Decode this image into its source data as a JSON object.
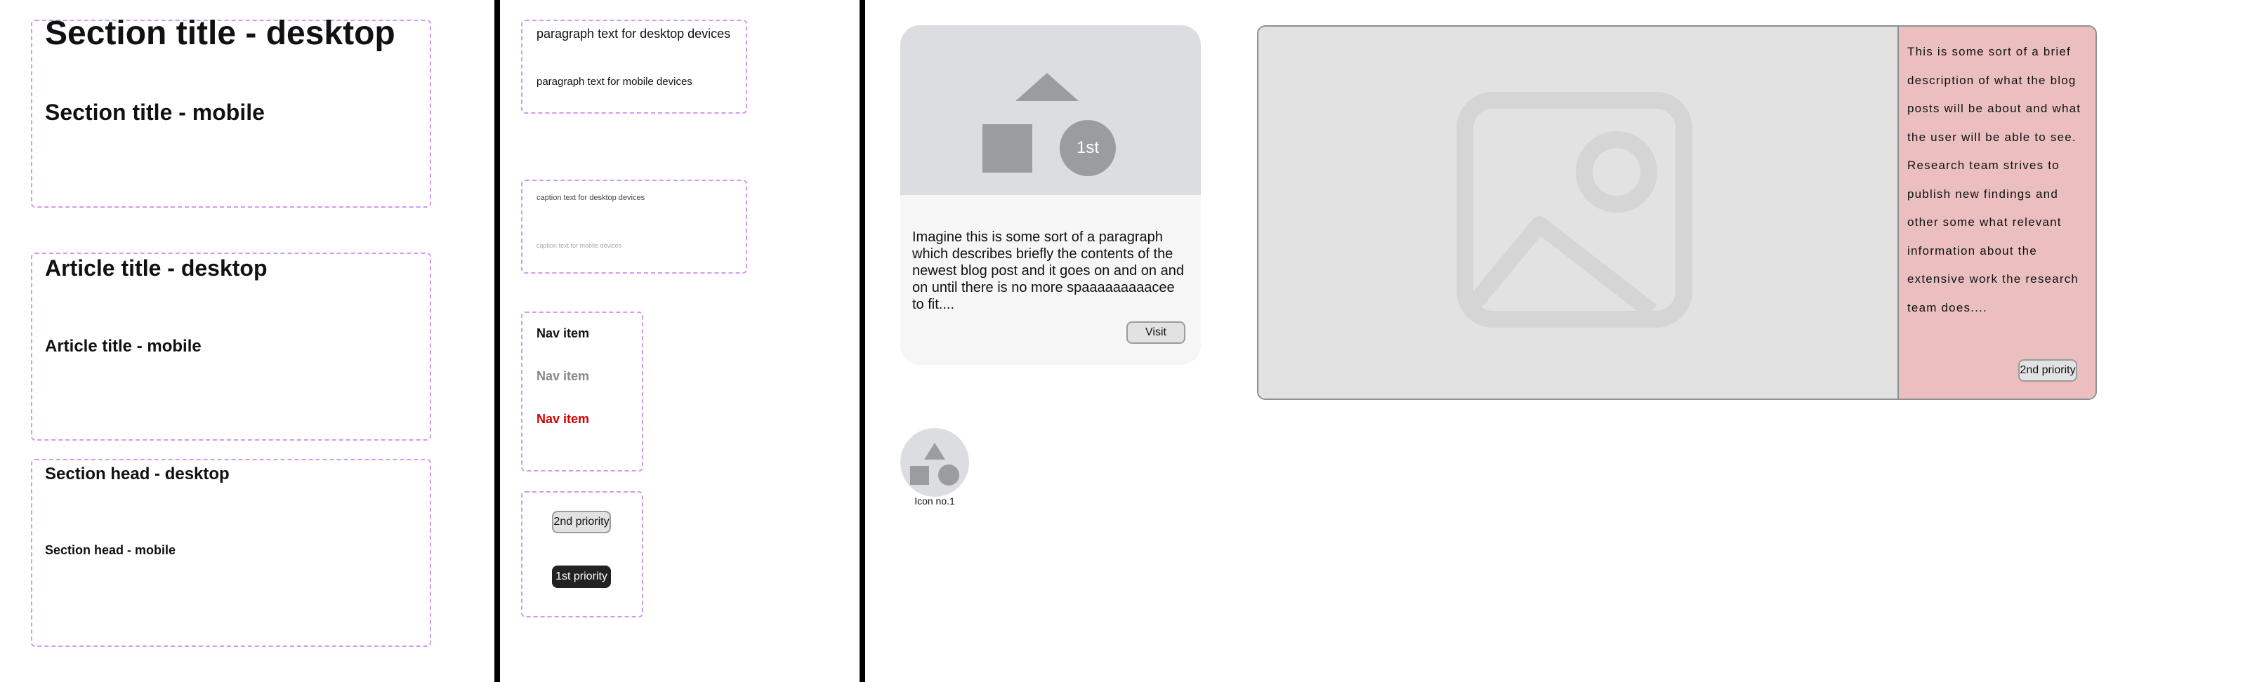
{
  "typography": {
    "section_title_desktop": "Section title - desktop",
    "section_title_mobile": "Section title - mobile",
    "article_title_desktop": "Article title - desktop",
    "article_title_mobile": "Article title - mobile",
    "section_head_desktop": "Section head - desktop",
    "section_head_mobile": "Section head - mobile",
    "paragraph_desktop": "paragraph text for desktop devices",
    "paragraph_mobile": "paragraph text for mobile devices",
    "caption_desktop": "caption text for desktop devices",
    "caption_mobile": "caption text for mobile devices"
  },
  "nav": {
    "items": [
      {
        "label": "Nav item",
        "state": "default"
      },
      {
        "label": "Nav item",
        "state": "disabled"
      },
      {
        "label": "Nav item",
        "state": "active"
      }
    ]
  },
  "buttons": {
    "second_priority": "2nd priority",
    "first_priority": "1st priority"
  },
  "card": {
    "badge": "1st",
    "paragraph": "Imagine this is some sort of a paragraph which describes briefly the contents of the newest blog post and it goes on and on and on until there is no more spaaaaaaaaacee to fit....",
    "button": "Visit"
  },
  "icon_tile": {
    "label": "Icon no.1"
  },
  "feature": {
    "description": "This is some sort of a brief description of what the blog posts will be about and what the user will be able to see. Research team strives to publish new findings and other some what relevant information about the extensive work the research team does....",
    "button": "2nd priority"
  },
  "colors": {
    "dashed_border": "#cf9bf0",
    "active_nav": "#d40000",
    "disabled_nav": "#888888",
    "feature_panel": "#ebbfbf",
    "placeholder_bg": "#e2e2e4",
    "shape_gray": "#9a9ca0"
  },
  "icons": [
    "image-placeholder-icon",
    "triangle-shape",
    "square-shape",
    "circle-shape"
  ]
}
